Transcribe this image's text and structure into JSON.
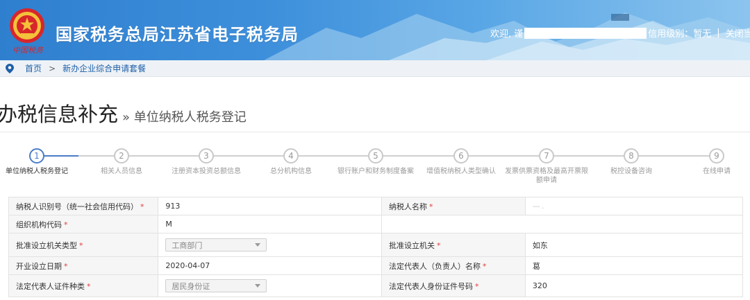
{
  "header": {
    "site_title": "国家税务总局江苏省电子税务局",
    "emblem_text": "中国税务",
    "welcome_prefix": "欢迎, 谨",
    "credit_label": "信用级别：暂无",
    "separator": "|",
    "close_label": "关闭当"
  },
  "breadcrumb": {
    "home": "首页",
    "arrow": ">",
    "current": "新办企业综合申请套餐"
  },
  "page": {
    "title": "办税信息补充",
    "subtitle": "» 单位纳税人税务登记"
  },
  "steps": [
    {
      "num": "1",
      "label": "单位纳税人税务登记",
      "active": true
    },
    {
      "num": "2",
      "label": "相关人员信息",
      "active": false
    },
    {
      "num": "3",
      "label": "注册资本投资总额信息",
      "active": false
    },
    {
      "num": "4",
      "label": "总分机构信息",
      "active": false
    },
    {
      "num": "5",
      "label": "银行账户和财务制度备案",
      "active": false
    },
    {
      "num": "6",
      "label": "增值税纳税人类型确认",
      "active": false
    },
    {
      "num": "7",
      "label": "发票供票资格及最高开票限额申请",
      "active": false
    },
    {
      "num": "8",
      "label": "税控设备咨询",
      "active": false
    },
    {
      "num": "9",
      "label": "在线申请",
      "active": false
    }
  ],
  "form": {
    "required_mark": "*",
    "taxpayer_id_label": "纳税人识别号（统一社会信用代码）",
    "taxpayer_id_value": "913",
    "taxpayer_name_label": "纳税人名称",
    "taxpayer_name_value": "—.",
    "org_code_label": "组织机构代码",
    "org_code_value": "M",
    "approval_type_label": "批准设立机关类型",
    "approval_type_value": "工商部门",
    "approval_org_label": "批准设立机关",
    "approval_org_value": "如东",
    "open_date_label": "开业设立日期",
    "open_date_value": "2020-04-07",
    "legal_rep_label": "法定代表人（负责人）名称",
    "legal_rep_value": "葛",
    "id_type_label": "法定代表人证件种类",
    "id_type_value": "居民身份证",
    "id_number_label": "法定代表人身份证件号码",
    "id_number_value": "320"
  },
  "colors": {
    "header_blue": "#3d8fdb",
    "link_blue": "#1e5fa8",
    "step_active": "#4a7cc7",
    "required_red": "#e23c3c"
  }
}
